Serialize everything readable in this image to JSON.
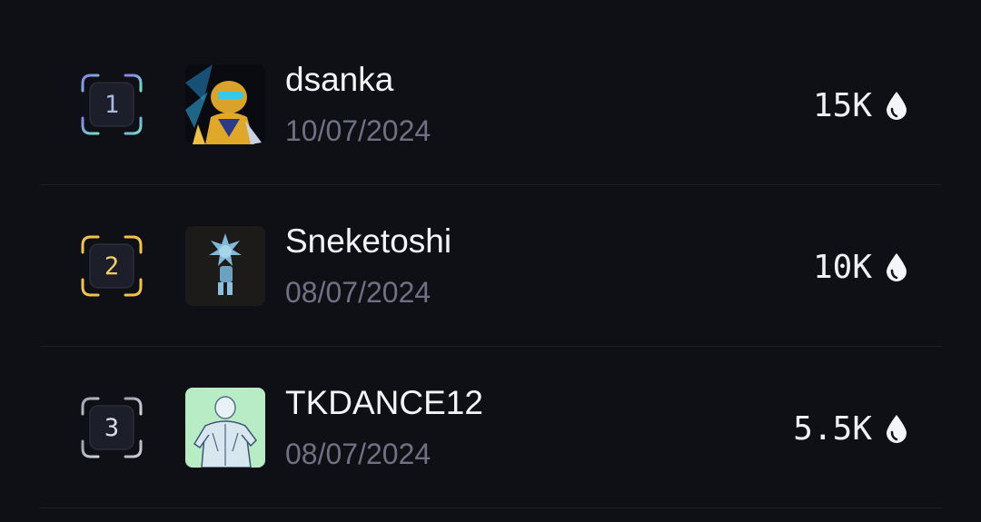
{
  "leaderboard": {
    "entries": [
      {
        "rank": "1",
        "name": "dsanka",
        "date": "10/07/2024",
        "score": "15K",
        "score_icon": "drop-icon",
        "rank_colors": [
          "#8e7cf0",
          "#6fe3c4"
        ]
      },
      {
        "rank": "2",
        "name": "Sneketoshi",
        "date": "08/07/2024",
        "score": "10K",
        "score_icon": "drop-icon",
        "rank_colors": [
          "#f3c24a",
          "#f3c24a"
        ]
      },
      {
        "rank": "3",
        "name": "TKDANCE12",
        "date": "08/07/2024",
        "score": "5.5K",
        "score_icon": "drop-icon",
        "rank_colors": [
          "#9aa0ae",
          "#cfd3dc"
        ]
      }
    ]
  }
}
